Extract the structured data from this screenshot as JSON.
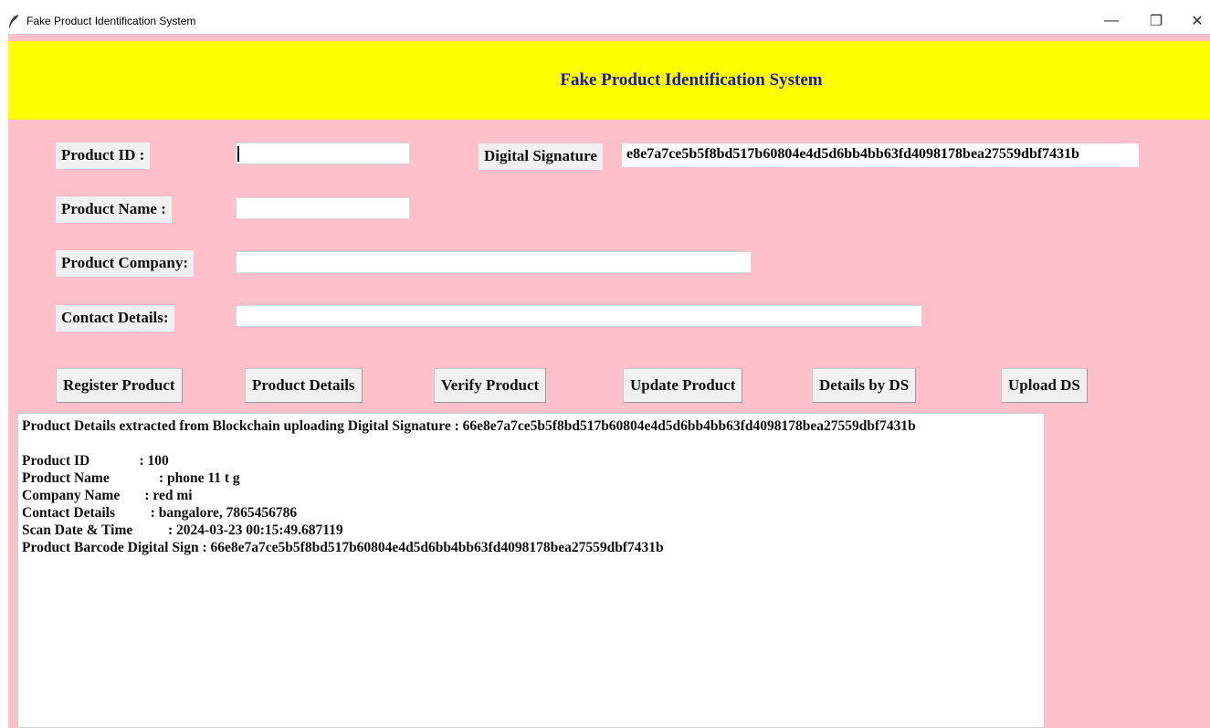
{
  "window": {
    "title": "Fake Product Identification System",
    "min_symbol": "—",
    "max_symbol": "❐",
    "close_symbol": "✕"
  },
  "header": {
    "title": "Fake Product Identification System",
    "background": "#ffff00",
    "title_color": "#1a1aa8"
  },
  "background_color": "#ffc0cb",
  "form": {
    "product_id_label": "Product ID :",
    "product_id_value": "",
    "product_name_label": "Product Name :",
    "product_name_value": "",
    "product_company_label": "Product Company:",
    "product_company_value": "",
    "contact_details_label": "Contact Details:",
    "contact_details_value": "",
    "digital_signature_label": "Digital Signature",
    "digital_signature_value": "e8e7a7ce5b5f8bd517b60804e4d5d6bb4bb63fd4098178bea27559dbf7431b"
  },
  "buttons": {
    "register": "Register Product",
    "details": "Product Details",
    "verify": "Verify Product",
    "update": "Update Product",
    "details_by_ds": "Details by DS",
    "upload_ds": "Upload DS"
  },
  "output": {
    "lines": [
      "Product Details extracted from Blockchain uploading Digital Signature : 66e8e7a7ce5b5f8bd517b60804e4d5d6bb4bb63fd4098178bea27559dbf7431b",
      "",
      "Product ID              : 100",
      "Product Name              : phone 11 t g",
      "Company Name       : red mi",
      "Contact Details          : bangalore, 7865456786",
      "Scan Date & Time          : 2024-03-23 00:15:49.687119",
      "Product Barcode Digital Sign : 66e8e7a7ce5b5f8bd517b60804e4d5d6bb4bb63fd4098178bea27559dbf7431b"
    ]
  },
  "icons": {
    "app": "feather-icon",
    "minimize": "minimize-icon",
    "maximize": "maximize-icon",
    "close": "close-icon"
  }
}
